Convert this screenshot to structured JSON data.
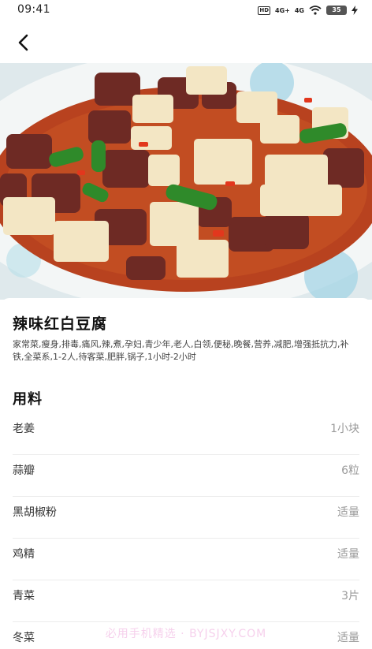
{
  "status_bar": {
    "time": "09:41",
    "hd_label": "HD",
    "signal_1": "4G+",
    "signal_2": "4G",
    "battery": "35",
    "icons": [
      "wifi-icon",
      "charging-bolt-icon"
    ]
  },
  "nav": {
    "back_icon": "chevron-left-icon"
  },
  "hero": {
    "subject": "dish-photo"
  },
  "recipe": {
    "title": "辣味红白豆腐",
    "tags": "家常菜,瘦身,排毒,痛风,辣,煮,孕妇,青少年,老人,白领,便秘,晚餐,营养,减肥,增强抵抗力,补铁,全菜系,1-2人,待客菜,肥胖,锅子,1小时-2小时"
  },
  "ingredients": {
    "section_title": "用料",
    "items": [
      {
        "name": "老姜",
        "amount": "1小块"
      },
      {
        "name": "蒜瓣",
        "amount": "6粒"
      },
      {
        "name": "黑胡椒粉",
        "amount": "适量"
      },
      {
        "name": "鸡精",
        "amount": "适量"
      },
      {
        "name": "青菜",
        "amount": "3片"
      },
      {
        "name": "冬菜",
        "amount": "适量"
      }
    ]
  },
  "watermark": "必用手机精选 · BYJSJXY.COM"
}
